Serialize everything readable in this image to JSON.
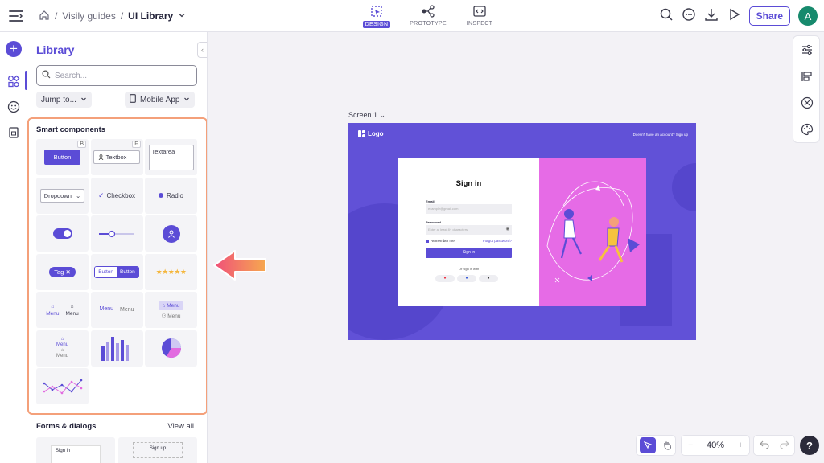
{
  "topbar": {
    "breadcrumbs": {
      "project": "Visily guides",
      "file": "UI Library",
      "sep": "/"
    },
    "modes": [
      {
        "label": "DESIGN",
        "active": true
      },
      {
        "label": "PROTOTYPE",
        "active": false
      },
      {
        "label": "INSPECT",
        "active": false
      }
    ],
    "share_label": "Share",
    "avatar_initial": "A"
  },
  "rail": {
    "add_label": "+"
  },
  "library": {
    "title": "Library",
    "search_placeholder": "Search...",
    "jump_label": "Jump to...",
    "device_label": "Mobile App",
    "smart_title": "Smart components",
    "smart": {
      "button": "Button",
      "button_key": "B",
      "textbox": "Textbox",
      "textbox_key": "F",
      "textarea": "Textarea",
      "dropdown": "Dropdown",
      "checkbox": "Checkbox",
      "radio": "Radio",
      "tag": "Tag",
      "seg_a": "Button",
      "seg_b": "Button",
      "stars": "★★★★★",
      "menu": "Menu"
    },
    "forms_title": "Forms & dialogs",
    "view_all": "View all",
    "forms_preview_a": "Sign in",
    "forms_preview_b": "Sign up"
  },
  "canvas": {
    "screen_label": "Screen 1",
    "frame": {
      "logo": "Logo",
      "signup_prompt": "Doesn't have an account?",
      "signup_link": "Sign up",
      "signin_title": "Sign in",
      "email_label": "Email",
      "email_placeholder": "example@gmail.com",
      "password_label": "Password",
      "password_placeholder": "Enter at least 8+ characters",
      "remember": "Remember me",
      "forgot": "Forgot password?",
      "signin_button": "Sign in",
      "or_signin": "Or sign in with"
    }
  },
  "zoom": {
    "value": "40%",
    "minus": "−",
    "plus": "+"
  },
  "help_label": "?",
  "colors": {
    "accent": "#5b4cd6",
    "frame_bg": "#6151d7",
    "highlight": "#f4a07a",
    "illustration_bg": "#e66be6"
  }
}
